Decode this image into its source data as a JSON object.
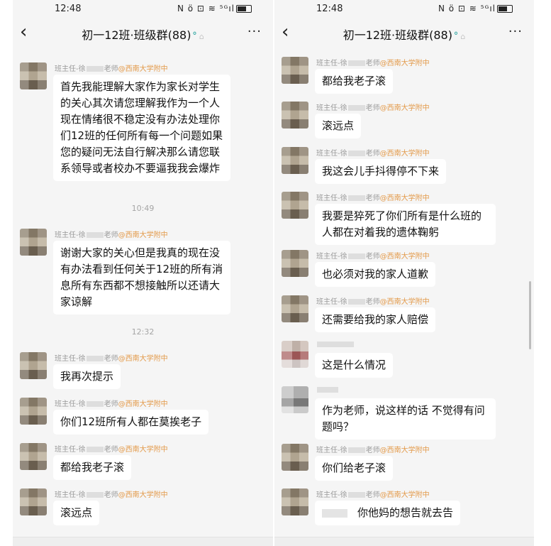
{
  "status_bar": {
    "time": "12:48",
    "icons": "N ö ⊡ ≋ ⁵ᴳıl"
  },
  "header": {
    "back_icon": "chevron-left-icon",
    "title": "初一12班·班级群(88)",
    "badge_icon": "group-chat-icon",
    "more_icon": "ellipsis-icon"
  },
  "colors": {
    "org_tag": "#e39a4a",
    "bubble": "#ffffff",
    "background": "#f5f5f5",
    "badge": "#2aa5a0"
  },
  "left_panel": {
    "messages": [
      {
        "sender": "班主任-徐",
        "sender_suffix": "老师",
        "org": "@西南大学附中",
        "text": "首先我能理解大家作为家长对学生的关心其次请您理解我作为一个人现在情绪很不稳定没有办法处理你们12班的任何所有每一个问题如果您的疑问无法自行解决那么请您联系领导或者校办不要逼我我会爆炸"
      },
      {
        "sender": "班主任-徐",
        "sender_suffix": "老师",
        "org": "@西南大学附中",
        "text": "谢谢大家的关心但是我真的现在没有办法看到任何关于12班的所有消息所有东西都不想接触所以还请大家谅解"
      },
      {
        "sender": "班主任-徐",
        "sender_suffix": "老师",
        "org": "@西南大学附中",
        "text": "我再次提示"
      },
      {
        "sender": "班主任-徐",
        "sender_suffix": "老师",
        "org": "@西南大学附中",
        "text": "你们12班所有人都在莫挨老子"
      },
      {
        "sender": "班主任-徐",
        "sender_suffix": "老师",
        "org": "@西南大学附中",
        "text": "都给我老子滚"
      },
      {
        "sender": "班主任-徐",
        "sender_suffix": "老师",
        "org": "@西南大学附中",
        "text": "滚远点"
      }
    ],
    "timestamps": [
      "10:49",
      "12:32"
    ]
  },
  "right_panel": {
    "messages": [
      {
        "sender": "班主任-徐",
        "sender_suffix": "老师",
        "org": "@西南大学附中",
        "text": "都给我老子滚"
      },
      {
        "sender": "班主任-徐",
        "sender_suffix": "老师",
        "org": "@西南大学附中",
        "text": "滚远点"
      },
      {
        "sender": "班主任-徐",
        "sender_suffix": "老师",
        "org": "@西南大学附中",
        "text": "我这会儿手抖得停不下来"
      },
      {
        "sender": "班主任-徐",
        "sender_suffix": "老师",
        "org": "@西南大学附中",
        "text": "我要是猝死了你们所有是什么班的人都在对着我的遗体鞠躬"
      },
      {
        "sender": "班主任-徐",
        "sender_suffix": "老师",
        "org": "@西南大学附中",
        "text": "也必须对我的家人道歉"
      },
      {
        "sender": "班主任-徐",
        "sender_suffix": "老师",
        "org": "@西南大学附中",
        "text": "还需要给我的家人赔偿"
      },
      {
        "sender": "",
        "sender_suffix": "",
        "org": "",
        "text": "这是什么情况"
      },
      {
        "sender": "",
        "sender_suffix": "",
        "org": "",
        "text": "作为老师，说这样的话 不觉得有问题吗？"
      },
      {
        "sender": "班主任-徐",
        "sender_suffix": "老师",
        "org": "@西南大学附中",
        "text": "你们给老子滚"
      },
      {
        "sender": "班主任-徐",
        "sender_suffix": "老师",
        "org": "@西南大学附中",
        "text": "你他妈的想告就去告"
      }
    ]
  }
}
